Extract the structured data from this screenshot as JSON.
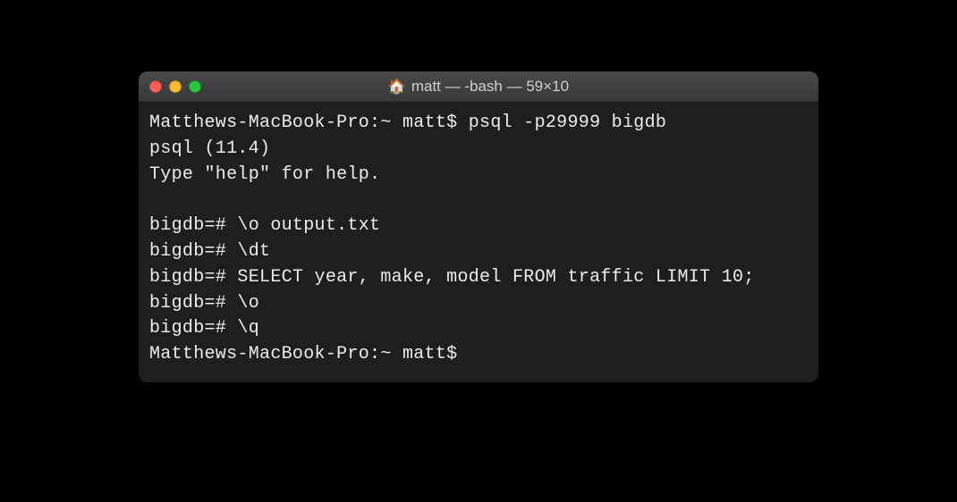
{
  "window": {
    "title": "matt — -bash — 59×10",
    "icon": "🏠"
  },
  "terminal": {
    "lines": [
      "Matthews-MacBook-Pro:~ matt$ psql -p29999 bigdb",
      "psql (11.4)",
      "Type \"help\" for help.",
      "",
      "bigdb=# \\o output.txt",
      "bigdb=# \\dt",
      "bigdb=# SELECT year, make, model FROM traffic LIMIT 10;",
      "bigdb=# \\o",
      "bigdb=# \\q",
      "Matthews-MacBook-Pro:~ matt$ "
    ]
  }
}
